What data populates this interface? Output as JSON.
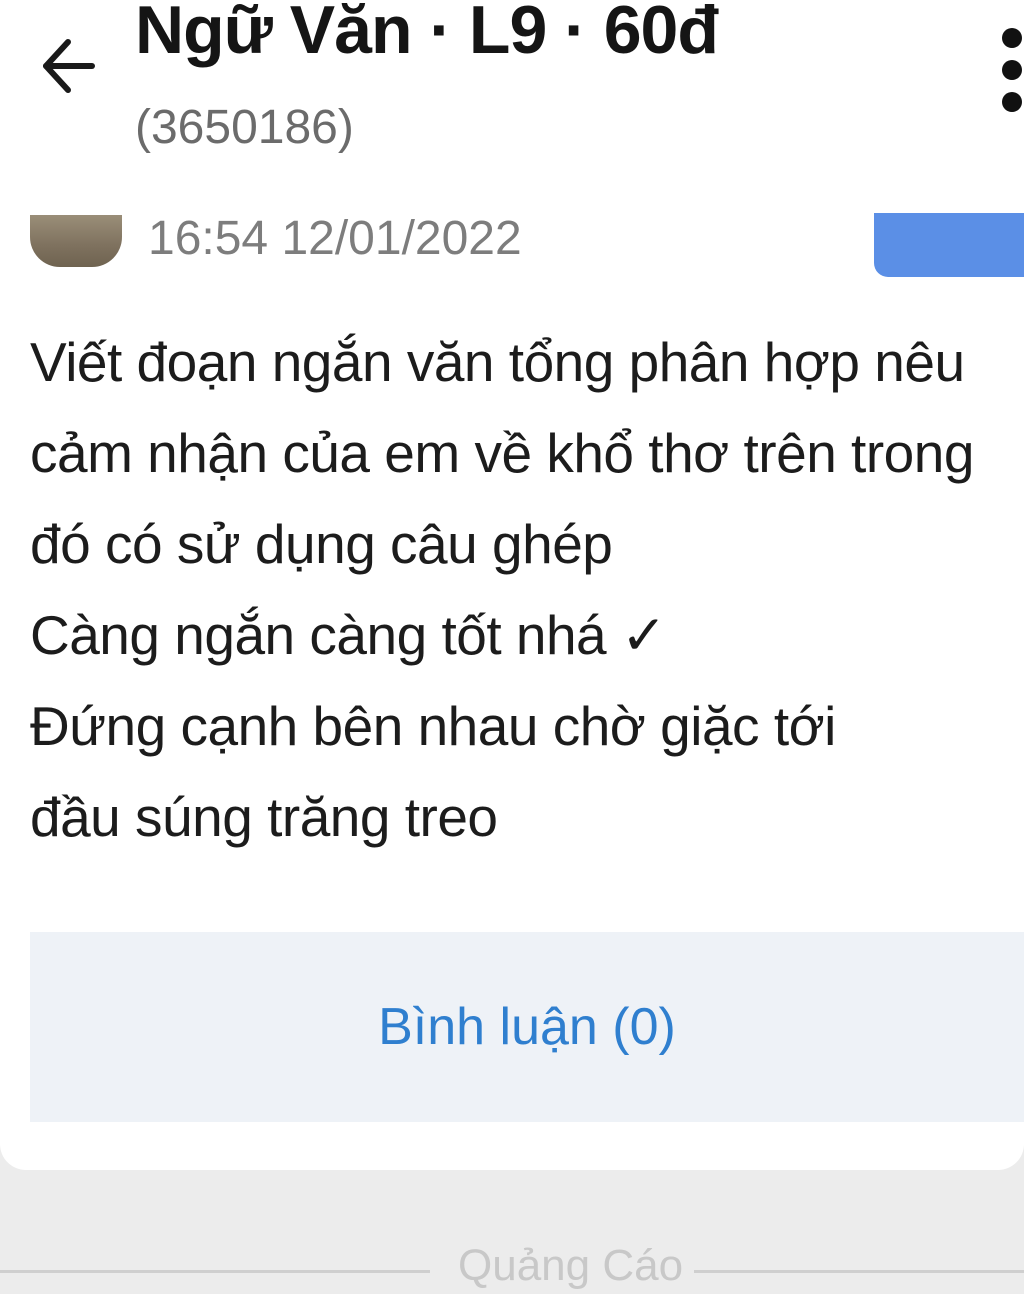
{
  "header": {
    "title": "Ngữ Văn · L9 · 60đ",
    "subtitle": "(3650186)",
    "back_icon": "arrow-left-icon",
    "more_icon": "more-vertical-icon"
  },
  "post": {
    "timestamp": "16:54 12/01/2022",
    "content_lines": [
      "Viết đoạn ngắn văn tổng phân hợp nêu cảm nhận của em về khổ thơ trên trong đó có sử dụng câu ghép",
      "Càng ngắn càng tốt nhá ✓",
      "Đứng cạnh bên nhau chờ giặc tới",
      "đầu súng trăng treo"
    ],
    "comment_label": "Bình luận (0)"
  },
  "ad": {
    "label": "Quảng Cáo"
  },
  "colors": {
    "accent": "#5b8fe6",
    "comment_text": "#2f7fcf",
    "comment_bg": "#eef2f7"
  }
}
